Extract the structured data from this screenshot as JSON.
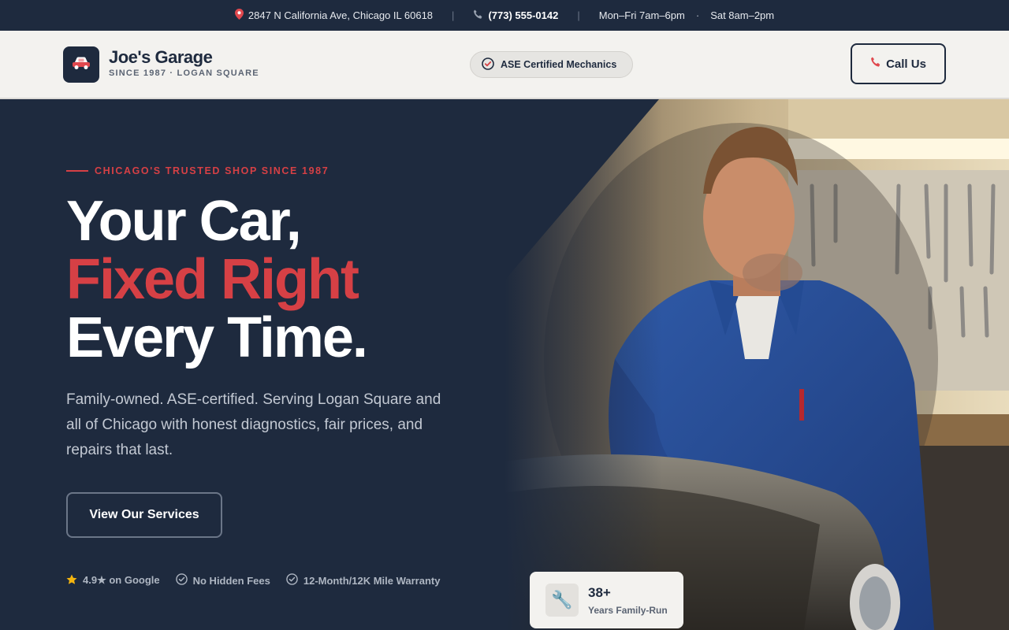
{
  "topbar": {
    "address": "2847 N California Ave, Chicago IL 60618",
    "phone": "(773) 555-0142",
    "hours_weekday": "Mon–Fri 7am–6pm",
    "hours_sat": "Sat 8am–2pm"
  },
  "header": {
    "brand_name": "Joe's Garage",
    "brand_sub": "SINCE 1987 · LOGAN SQUARE",
    "cert_badge": "ASE Certified Mechanics",
    "call_label": "Call Us"
  },
  "hero": {
    "eyebrow": "CHICAGO'S TRUSTED SHOP SINCE 1987",
    "headline_1": "Your Car,",
    "headline_2": "Fixed Right",
    "headline_3": "Every Time.",
    "lead": "Family-owned. ASE-certified. Serving Logan Square and all of Chicago with honest diagnostics, fair prices, and repairs that last.",
    "cta_label": "View Our Services",
    "trust": [
      {
        "label": "4.9★ on Google",
        "icon": "star-icon"
      },
      {
        "label": "No Hidden Fees",
        "icon": "check-circle-icon"
      },
      {
        "label": "12-Month/12K Mile Warranty",
        "icon": "check-circle-icon"
      }
    ],
    "stat": {
      "value": "38+",
      "label": "Years Family-Run",
      "icon": "wrench-icon"
    }
  },
  "colors": {
    "navy": "#1e2a3e",
    "accent_red": "#d64045",
    "cream": "#f3f2ef"
  }
}
